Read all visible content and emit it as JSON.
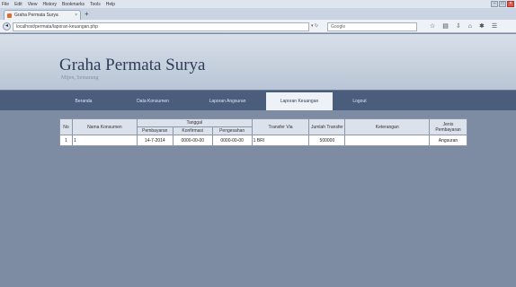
{
  "browser": {
    "menu_items": [
      "File",
      "Edit",
      "View",
      "History",
      "Bookmarks",
      "Tools",
      "Help"
    ],
    "tab_title": "Graha Permata Surya",
    "url": "localhost/permata/laporan-keuangan.php",
    "search_placeholder": "Google",
    "window_controls": [
      "minimize",
      "maximize",
      "close"
    ]
  },
  "site": {
    "title": "Graha Permata Surya",
    "subtitle": "Mijen, Semarang"
  },
  "nav": {
    "items": [
      {
        "label": "Beranda"
      },
      {
        "label": "Data Konsumen"
      },
      {
        "label": "Laporan Angsuran"
      },
      {
        "label": "Laporan Keuangan",
        "active": true
      },
      {
        "label": "Logout"
      }
    ]
  },
  "table": {
    "headers": {
      "no": "No",
      "nama": "Nama Konsumen",
      "tanggal": "Tanggal",
      "pembayaran": "Pembayaran",
      "konfirmasi": "Konfirmasi",
      "pengesahan": "Pengesahan",
      "transfer": "Transfer Via",
      "jumlah": "Jumlah Transfer",
      "keterangan": "Keterangan",
      "jenis": "Jenis Pembayaran"
    },
    "rows": [
      {
        "no": "1",
        "nama": "1",
        "pembayaran": "14-7-2014",
        "konfirmasi": "0000-00-00",
        "pengesahan": "0000-00-00",
        "transfer": "1 BRI",
        "jumlah": "500000",
        "keterangan": "",
        "jenis": "Angsuran"
      }
    ]
  }
}
